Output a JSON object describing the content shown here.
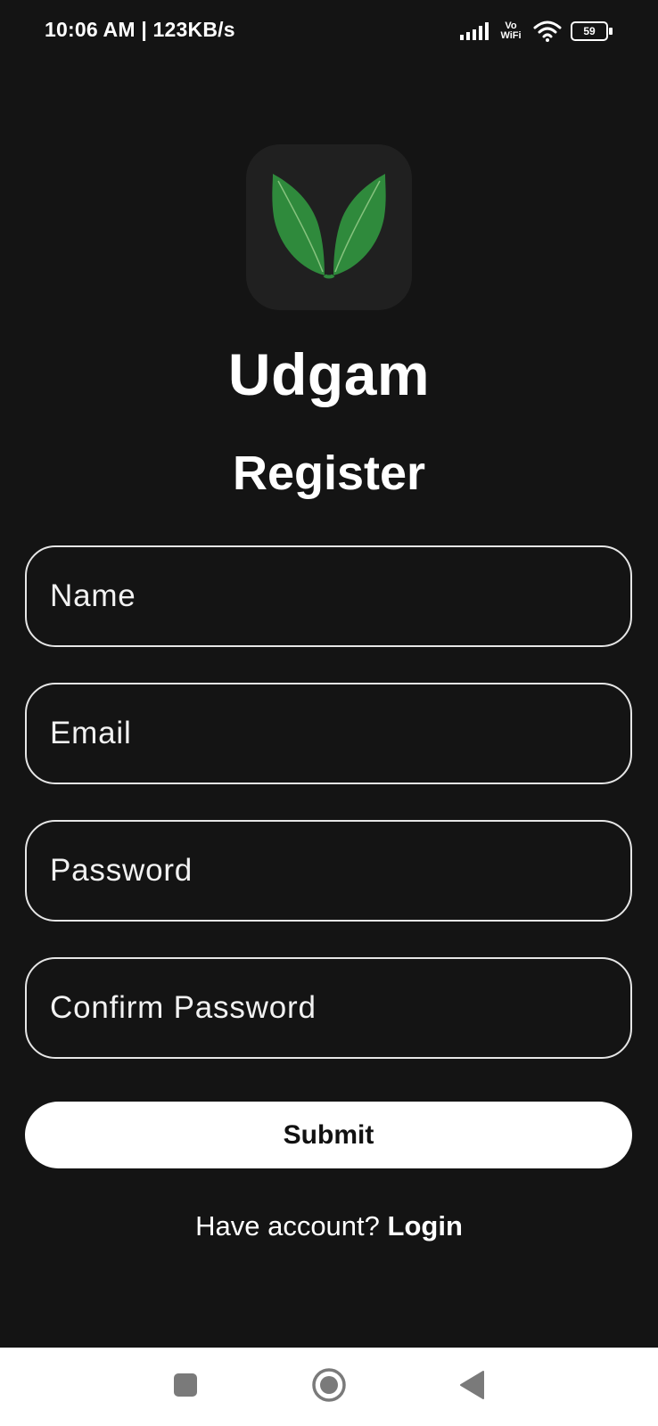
{
  "status_bar": {
    "time_speed": "10:06 AM | 123KB/s",
    "vowifi_top": "Vo",
    "vowifi_bottom": "WiFi",
    "battery_level": "59",
    "icons": [
      "signal-icon",
      "vowifi-icon",
      "wifi-icon",
      "battery-icon"
    ]
  },
  "app": {
    "logo_icon": "leaf-logo-icon",
    "name": "Udgam",
    "screen_title": "Register",
    "colors": {
      "background": "#141414",
      "logo_tile": "#202020",
      "leaf_green": "#2f8a3c",
      "field_border": "#e6e6e6",
      "button_bg": "#ffffff",
      "button_text": "#111111"
    }
  },
  "form": {
    "name": {
      "placeholder": "Name",
      "value": ""
    },
    "email": {
      "placeholder": "Email",
      "value": ""
    },
    "password": {
      "placeholder": "Password",
      "value": ""
    },
    "confirm_password": {
      "placeholder": "Confirm Password",
      "value": ""
    },
    "submit_label": "Submit"
  },
  "footer": {
    "prompt": "Have account?",
    "login_label": "Login"
  },
  "nav_bar": {
    "icons": [
      "recents-square-icon",
      "home-circle-icon",
      "back-triangle-icon"
    ]
  }
}
